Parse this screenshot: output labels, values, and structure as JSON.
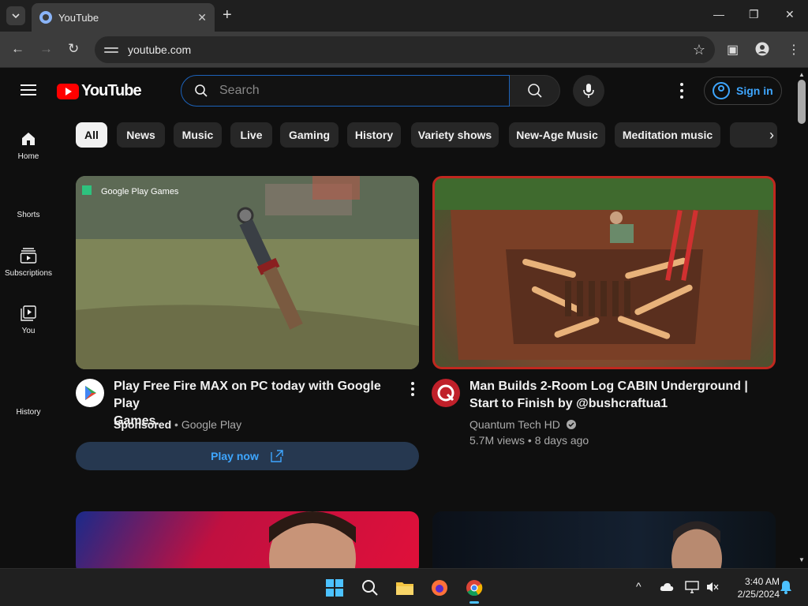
{
  "browser": {
    "tab_title": "YouTube",
    "url": "youtube.com"
  },
  "header": {
    "logo_text": "YouTube",
    "search_placeholder": "Search",
    "signin_label": "Sign in"
  },
  "sidebar": {
    "items": [
      {
        "label": "Home",
        "icon": "home-icon"
      },
      {
        "label": "Shorts",
        "icon": "shorts-icon"
      },
      {
        "label": "Subscriptions",
        "icon": "subscriptions-icon"
      },
      {
        "label": "You",
        "icon": "you-icon"
      },
      {
        "label": "History",
        "icon": "history-icon"
      }
    ]
  },
  "chips": [
    "All",
    "News",
    "Music",
    "Live",
    "Gaming",
    "History",
    "Variety shows",
    "New-Age Music",
    "Meditation music"
  ],
  "videos": [
    {
      "thumb_overlay": "Google Play Games",
      "title_line1": "Play Free Fire MAX on PC today with Google Play",
      "title_line2": "Games.",
      "sponsored": "Sponsored",
      "channel": "Google Play",
      "cta": "Play now"
    },
    {
      "title_line1": "Man Builds 2-Room Log CABIN Underground |",
      "title_line2": "Start to Finish by @bushcraftua1",
      "channel": "Quantum Tech HD",
      "views": "5.7M views",
      "age": "8 days ago"
    }
  ],
  "taskbar": {
    "time": "3:40 AM",
    "date": "2/25/2024"
  },
  "colors": {
    "accent_blue": "#3ea6ff",
    "youtube_red": "#ff0000",
    "background": "#0f0f0f"
  }
}
